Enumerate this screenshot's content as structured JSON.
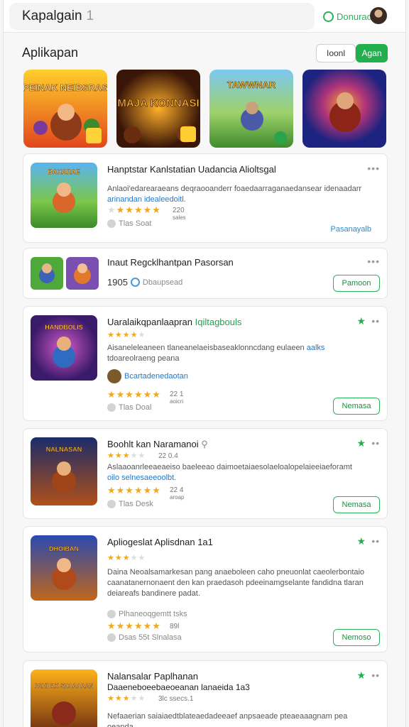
{
  "header": {
    "title": "Kapalgain",
    "count": "1",
    "signin_label": "Donurad"
  },
  "section": {
    "title": "Aplikapan",
    "filters": [
      "Ioonl",
      "Agan"
    ]
  },
  "featured": [
    {
      "name": "PEINAK NEIBSRAS",
      "colors": [
        "#ffb400",
        "#d9431b"
      ]
    },
    {
      "name": "MAJA KONNASI",
      "colors": [
        "#5a2612",
        "#f08a1a"
      ]
    },
    {
      "name": "TAWWNAR",
      "colors": [
        "#59b6e8",
        "#58a43a"
      ]
    },
    {
      "name": "",
      "colors": [
        "#1f2a8c",
        "#d13a7a"
      ]
    }
  ],
  "cards": [
    {
      "title": "Hanptstar Kanlstatian Uadancia Alioltsgal",
      "desc": "Anlaoi'edarearaeans deqraooanderr foaedaarraganaedansear idenaadarr",
      "desc_link": "arinandan idealeedoitl.",
      "rating": "220",
      "rating_sub": "sales",
      "meta": "Tlas Soat",
      "link": "Pasanayalb",
      "thumb_label": "BAHARAE"
    },
    {
      "title": "Inaut Regcklhantpan Pasorsan",
      "meta_num": "1905",
      "meta_label": "Dbaupsead",
      "button": "Pamoon"
    },
    {
      "title": "Uaralaikqpanlaapran",
      "title_green": "Iqiltagbouls",
      "desc": "Aisaneleleaneen tlaneanelaeisbaseaklonncdang eulaeen",
      "desc_link": "aalks",
      "desc2": "tdoareolraeng peana",
      "sub_label": "Bcartadenedaotan",
      "rating": "22 1",
      "rating_sub": "aoicri",
      "meta": "Tlas Doal",
      "button": "Nemasa",
      "thumb_label": "HANDBOLIS"
    },
    {
      "title": "Boohlt kan Naramanoi",
      "desc": "Aslaaoanrleeaeaeiso baeleeao daimoetaiaesolaeloalopelaieeiaeforamt",
      "desc_link": "oilo selnesaeeoolbt.",
      "rating_top": "22 0.4",
      "rating": "22 4",
      "rating_sub": "aroap",
      "meta": "Tlas Desk",
      "button": "Nemasa",
      "thumb_label": "NALNASAN"
    },
    {
      "title": "Apliogeslat Aplisdnan 1a1",
      "desc": "Daina Neoalsamarkesan pang anaeboleen caho pneuonlat caeolerbontaio caanatanernonaent den kan praedasoh pdeeinamgselante fandidna tlaran deiareafs bandinere padat.",
      "sub_label": "Plhaneoqgemtt tsks",
      "rating": "89l",
      "meta": "Dsas 55t Slnalasa",
      "button": "Nemoso",
      "thumb_label": "DHOIBAN"
    },
    {
      "title": "Nalansalar Paplhanan",
      "subtitle": "Daaeneboeebaeoeanan lanaeida 1a3",
      "rating_top": "3lc ssecs.1",
      "desc": "Nefaaerian saiaiaedtblateaedadeeaef anpsaeade pteaeaaagnam pea oeanda",
      "thumb_label": "PAHDRK SHOAOAAN"
    }
  ]
}
